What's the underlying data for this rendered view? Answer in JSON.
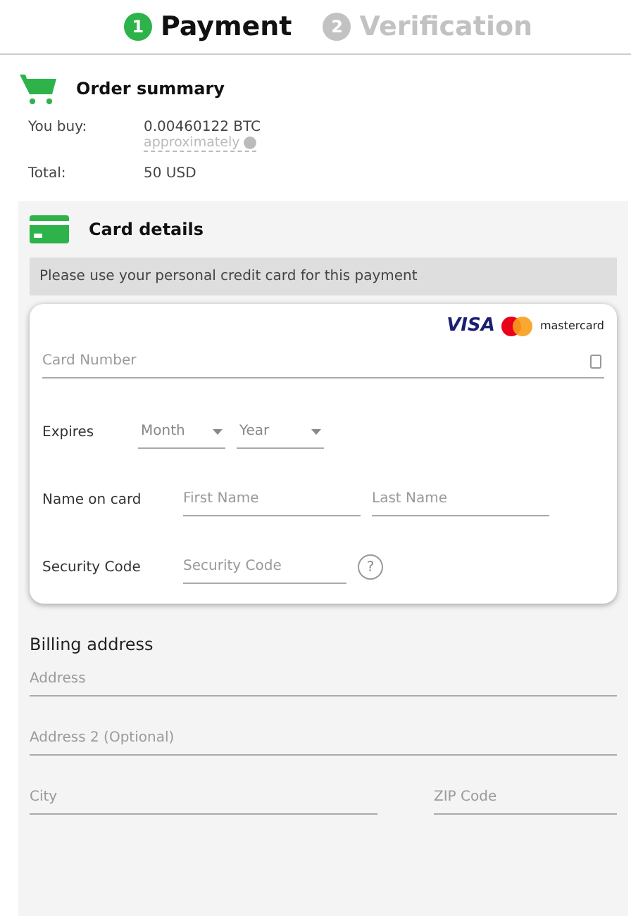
{
  "steps": [
    {
      "number": "1",
      "label": "Payment",
      "selected": true
    },
    {
      "number": "2",
      "label": "Verification",
      "selected": false
    }
  ],
  "order_summary": {
    "title": "Order summary",
    "rows": [
      {
        "label": "You buy:",
        "value": "0.00460122 BTC",
        "note": "approximately"
      },
      {
        "label": "Total:",
        "value": "50 USD"
      }
    ]
  },
  "card_details": {
    "title": "Card details",
    "notice": "Please use your personal credit card for this payment",
    "brands": [
      "VISA",
      "mastercard"
    ],
    "card_number": {
      "placeholder": "Card Number"
    },
    "expires": {
      "label": "Expires",
      "month": "Month",
      "year": "Year"
    },
    "name": {
      "label": "Name on card",
      "first": {
        "placeholder": "First Name"
      },
      "last": {
        "placeholder": "Last Name"
      }
    },
    "security": {
      "label": "Security Code",
      "placeholder": "Security Code",
      "help": "?"
    }
  },
  "billing": {
    "title": "Billing address",
    "address": {
      "placeholder": "Address"
    },
    "address2": {
      "placeholder": "Address 2 (Optional)"
    },
    "city": {
      "placeholder": "City"
    },
    "zip": {
      "placeholder": "ZIP Code"
    }
  }
}
